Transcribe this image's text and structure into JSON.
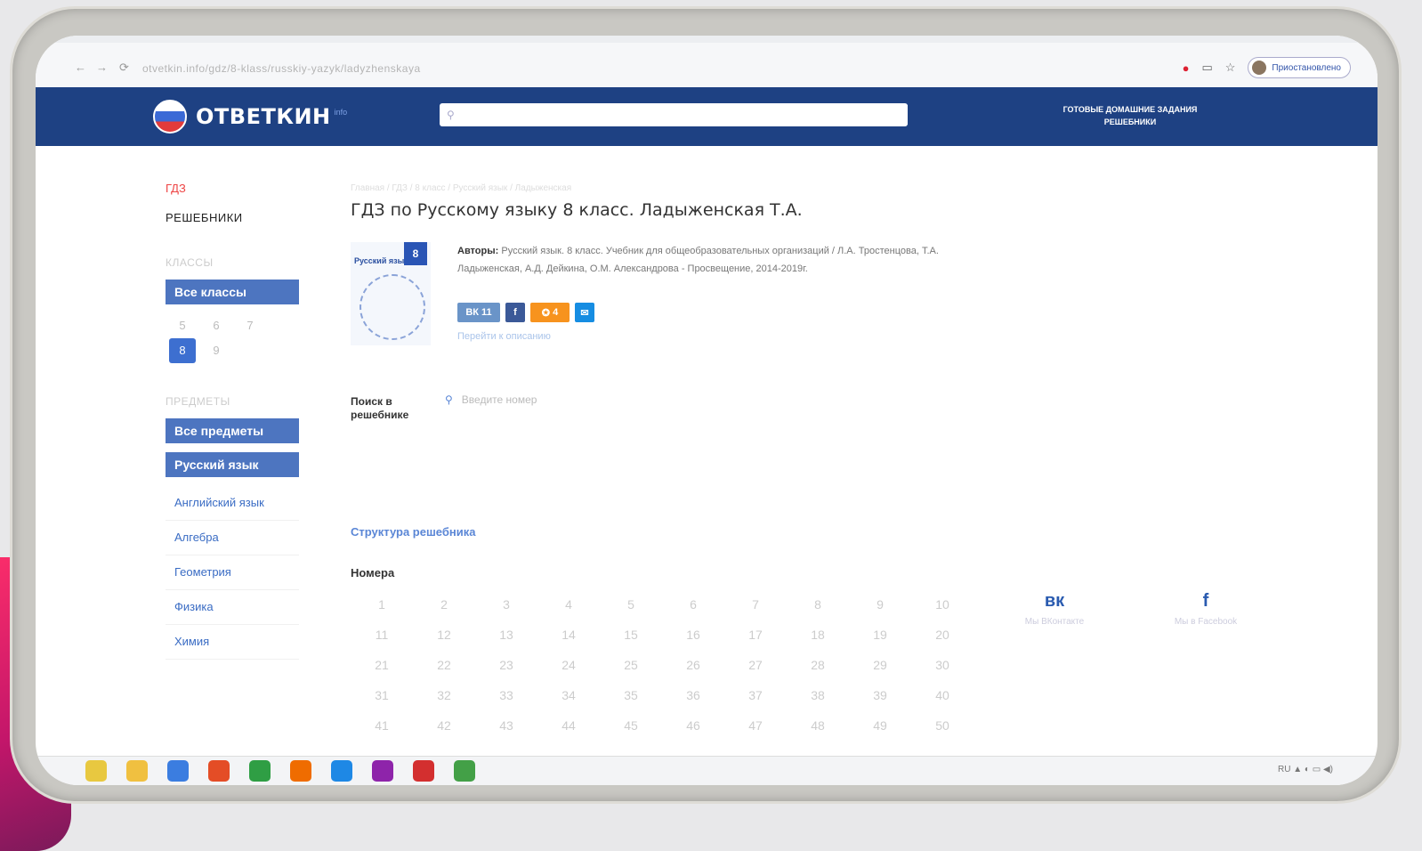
{
  "browser": {
    "address": "otvetkin.info/gdz/8-klass/russkiy-yazyk/ladyzhenskaya",
    "pause_label": "Приостановлено"
  },
  "header": {
    "logo_text": "ОТВЕТКИН",
    "logo_suffix": "info",
    "search_placeholder": "",
    "links": [
      "ГОТОВЫЕ ДОМАШНИЕ ЗАДАНИЯ",
      "РЕШЕБНИКИ"
    ]
  },
  "sidebar": {
    "link_gdz": "ГДЗ",
    "link_reshebniki": "РЕШЕБНИКИ",
    "classes_heading": "КЛАССЫ",
    "all_classes": "Все классы",
    "classes": [
      "5",
      "6",
      "7",
      "8",
      "9"
    ],
    "active_class": "8",
    "subjects_heading": "ПРЕДМЕТЫ",
    "all_subjects": "Все предметы",
    "active_subject": "Русский язык",
    "subjects": [
      "Английский язык",
      "Алгебра",
      "Геометрия",
      "Физика",
      "Химия"
    ]
  },
  "main": {
    "breadcrumb": "Главная / ГДЗ / 8 класс / Русский язык / Ладыженская",
    "title": "ГДЗ по Русскому языку 8 класс. Ладыженская Т.А.",
    "book_cover_title": "Русский язык",
    "book_grade": "8",
    "authors_label": "Авторы:",
    "authors_text": "Русский язык. 8 класс. Учебник для общеобразовательных организаций / Л.А. Тростенцова, Т.А. Ладыженская, А.Д. Дейкина, О.М. Александрова - Просвещение, 2014-2019г.",
    "share": {
      "vk": "ВК",
      "vk_count": "11",
      "fb": "f",
      "ok_count": "4",
      "mail": "✉"
    },
    "goto_desc": "Перейти к описанию",
    "search_label": "Поиск в решебнике",
    "search_placeholder": "Введите номер",
    "structure_link": "Структура решебника",
    "numbers_heading": "Номера",
    "numbers": [
      "1",
      "2",
      "3",
      "4",
      "5",
      "6",
      "7",
      "8",
      "9",
      "10",
      "11",
      "12",
      "13",
      "14",
      "15",
      "16",
      "17",
      "18",
      "19",
      "20",
      "21",
      "22",
      "23",
      "24",
      "25",
      "26",
      "27",
      "28",
      "29",
      "30",
      "31",
      "32",
      "33",
      "34",
      "35",
      "36",
      "37",
      "38",
      "39",
      "40",
      "41",
      "42",
      "43",
      "44",
      "45",
      "46",
      "47",
      "48",
      "49",
      "50"
    ]
  },
  "socials": {
    "vk_icon": "вк",
    "vk_label": "Мы ВКонтакте",
    "fb_icon": "f",
    "fb_label": "Мы в Facebook"
  },
  "taskbar": {
    "icon_colors": [
      "#e8c840",
      "#f0c040",
      "#3b7de0",
      "#e44d26",
      "#2f9e44",
      "#ef6c00",
      "#1e88e5",
      "#8e24aa",
      "#d32f2f",
      "#43a047"
    ],
    "tray_text": "RU ▲ ◐ ▭ ◀)"
  }
}
